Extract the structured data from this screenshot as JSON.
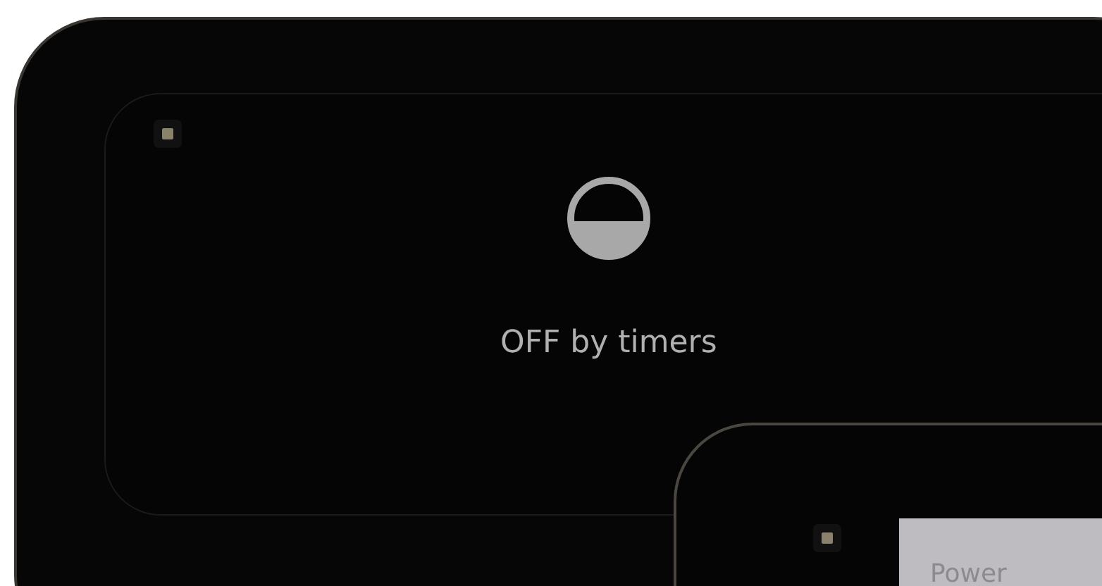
{
  "main_device": {
    "status_text": "OFF by timers"
  },
  "second_device": {
    "screen_label": "Power"
  }
}
